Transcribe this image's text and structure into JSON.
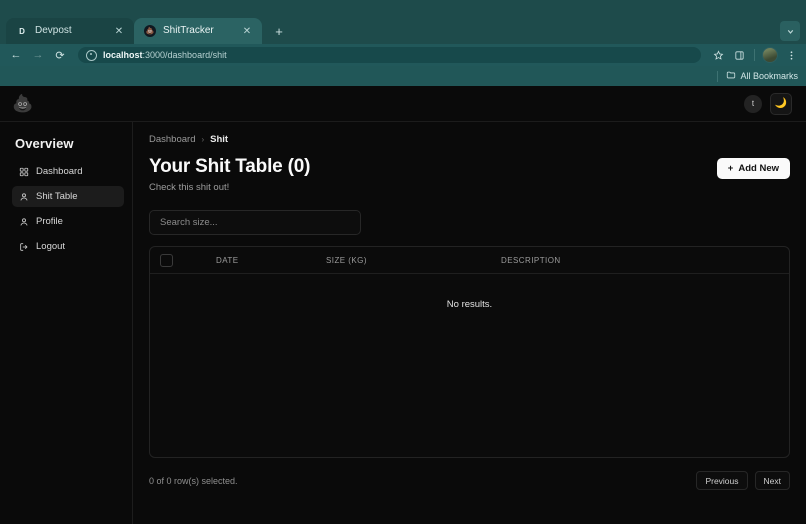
{
  "browser": {
    "tabs": [
      {
        "title": "Devpost",
        "favicon": "letter-d-favicon",
        "favicon_text": "D",
        "active": false
      },
      {
        "title": "ShitTracker",
        "favicon": "poop-circle-favicon",
        "favicon_text": "💩",
        "active": true
      }
    ],
    "new_tab_label": "+",
    "tab_list_icon": "chevron-down-icon",
    "nav": {
      "back": "←",
      "forward": "→",
      "reload": "⟳"
    },
    "omnibox": {
      "site_info_icon": "site-info-icon",
      "url_host": "localhost",
      "url_path": ":3000/dashboard/shit"
    },
    "toolbar_icons": [
      "bookmark-star-icon",
      "side-panel-icon",
      "profile-avatar",
      "three-dot-menu-icon"
    ],
    "bookmarks_bar": {
      "folder_icon": "folder-icon",
      "label": "All Bookmarks"
    }
  },
  "header": {
    "logo_icon": "poop-logo",
    "logo_glyph": "💩",
    "user_initial": "t",
    "theme_toggle_icon": "moon-icon",
    "theme_toggle_glyph": "🌙"
  },
  "sidebar": {
    "title": "Overview",
    "items": [
      {
        "label": "Dashboard",
        "icon": "grid-icon",
        "active": false
      },
      {
        "label": "Shit Table",
        "icon": "user-icon",
        "active": true
      },
      {
        "label": "Profile",
        "icon": "user-icon",
        "active": false
      },
      {
        "label": "Logout",
        "icon": "logout-icon",
        "active": false
      }
    ]
  },
  "main": {
    "breadcrumb": {
      "root": "Dashboard",
      "separator": "›",
      "current": "Shit"
    },
    "page_title": "Your Shit Table (0)",
    "page_subtitle": "Check this shit out!",
    "add_button": {
      "label": "Add New",
      "icon": "plus-icon",
      "glyph": "+"
    },
    "search": {
      "placeholder": "Search size...",
      "value": ""
    },
    "table": {
      "columns": [
        "DATE",
        "SIZE (KG)",
        "DESCRIPTION"
      ],
      "select_all_checkbox": false,
      "rows": [],
      "empty_message": "No results."
    },
    "footer": {
      "selection_text": "0 of 0 row(s) selected.",
      "previous_label": "Previous",
      "next_label": "Next"
    }
  },
  "colors": {
    "browser_chrome": "#1f4e4e",
    "app_background": "#0a0a0a",
    "accent_button": "#fafafa",
    "border": "#232323",
    "muted_text": "#9a9a9a"
  }
}
